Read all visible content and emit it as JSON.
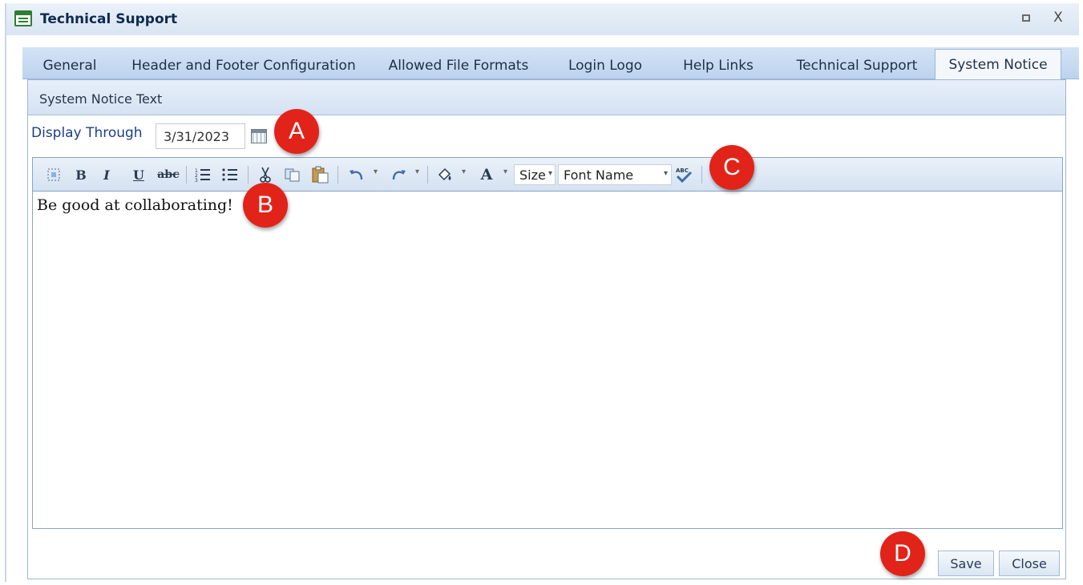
{
  "window": {
    "title": "Technical Support",
    "maximize_icon": "square-icon",
    "close_label": "X"
  },
  "tabs": [
    {
      "label": "General"
    },
    {
      "label": "Header and Footer Configuration"
    },
    {
      "label": "Allowed File Formats"
    },
    {
      "label": "Login Logo"
    },
    {
      "label": "Help Links"
    },
    {
      "label": "Technical Support"
    },
    {
      "label": "System Notice",
      "active": true
    }
  ],
  "panel": {
    "header": "System Notice Text",
    "display_through_label": "Display Through",
    "display_through_value": "3/31/2023"
  },
  "toolbar": {
    "bold": "B",
    "italic": "I",
    "underline": "U",
    "strikethrough": "abc",
    "font_color": "A",
    "size_label": "Size",
    "font_name_label": "Font Name",
    "spellcheck": "ABC"
  },
  "editor": {
    "content": "Be good at collaborating!"
  },
  "buttons": {
    "save": "Save",
    "close": "Close"
  },
  "markers": [
    "A",
    "B",
    "C",
    "D"
  ],
  "colors": {
    "marker": "#e2231a",
    "title_text": "#0f2a4f",
    "label_blue": "#1c3f86",
    "tab_bar": "#bcd3ee"
  }
}
